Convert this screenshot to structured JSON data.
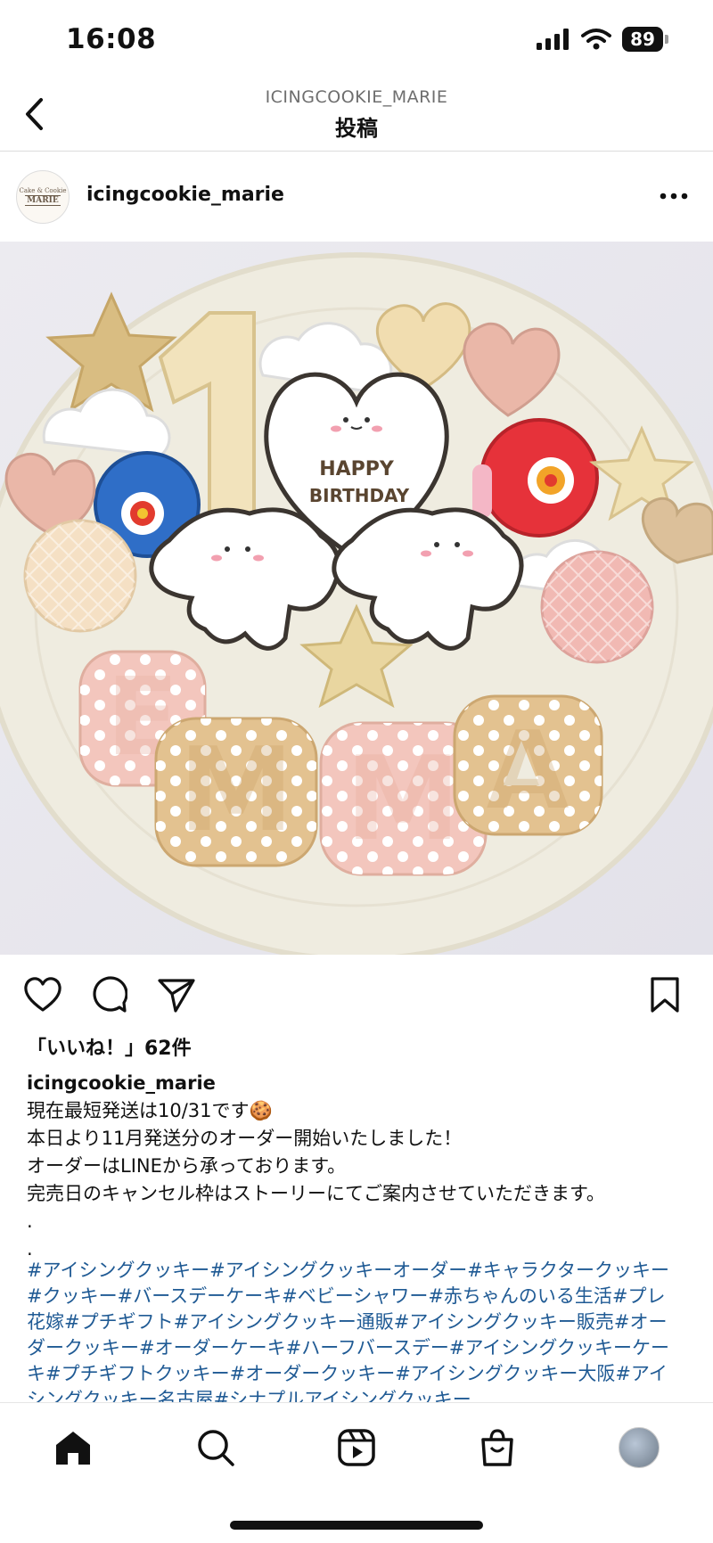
{
  "status": {
    "time": "16:08",
    "battery": "89"
  },
  "nav": {
    "subtitle": "ICINGCOOKIE_MARIE",
    "title": "投稿"
  },
  "post": {
    "username": "icingcookie_marie",
    "avatar_text": {
      "top": "Cake & Cookie",
      "main": "MARIE"
    },
    "cookie_text": {
      "line1": "HAPPY",
      "line2": "BIRTHDAY"
    },
    "name_cookies": [
      "E",
      "M",
      "M",
      "A"
    ],
    "likes": "「いいね！」62件",
    "caption": {
      "username": "icingcookie_marie",
      "line1": "現在最短発送は10/31です🍪",
      "line2": "本日より11月発送分のオーダー開始いたしました！",
      "line3": "オーダーはLINEから承っております。",
      "line4": "完売日のキャンセル枠はストーリーにてご案内させていただきます。",
      "dot1": ".",
      "dot2": "."
    },
    "hashtags": "#アイシングクッキー#アイシングクッキーオーダー#キャラクタークッキー#クッキー#バースデーケーキ#ベビーシャワー#赤ちゃんのいる生活#プレ花嫁#プチギフト#アイシングクッキー通販#アイシングクッキー販売#オーダークッキー#オーダーケーキ#ハーフバースデー#アイシングクッキーケーキ#プチギフトクッキー#オーダークッキー#アイシングクッキー大阪#アイシングクッキー名古屋#シナプルアイシングクッキー"
  },
  "icons": {
    "back": "chevron-left-icon",
    "more": "more-horizontal-icon",
    "like": "heart-icon",
    "comment": "comment-icon",
    "share": "send-icon",
    "save": "bookmark-icon",
    "tabs": [
      "home-icon",
      "search-icon",
      "reels-icon",
      "shop-icon",
      "profile-avatar"
    ]
  },
  "colors": {
    "hashtag": "#1f5a94",
    "text": "#111111",
    "muted": "#6e6e6e"
  }
}
